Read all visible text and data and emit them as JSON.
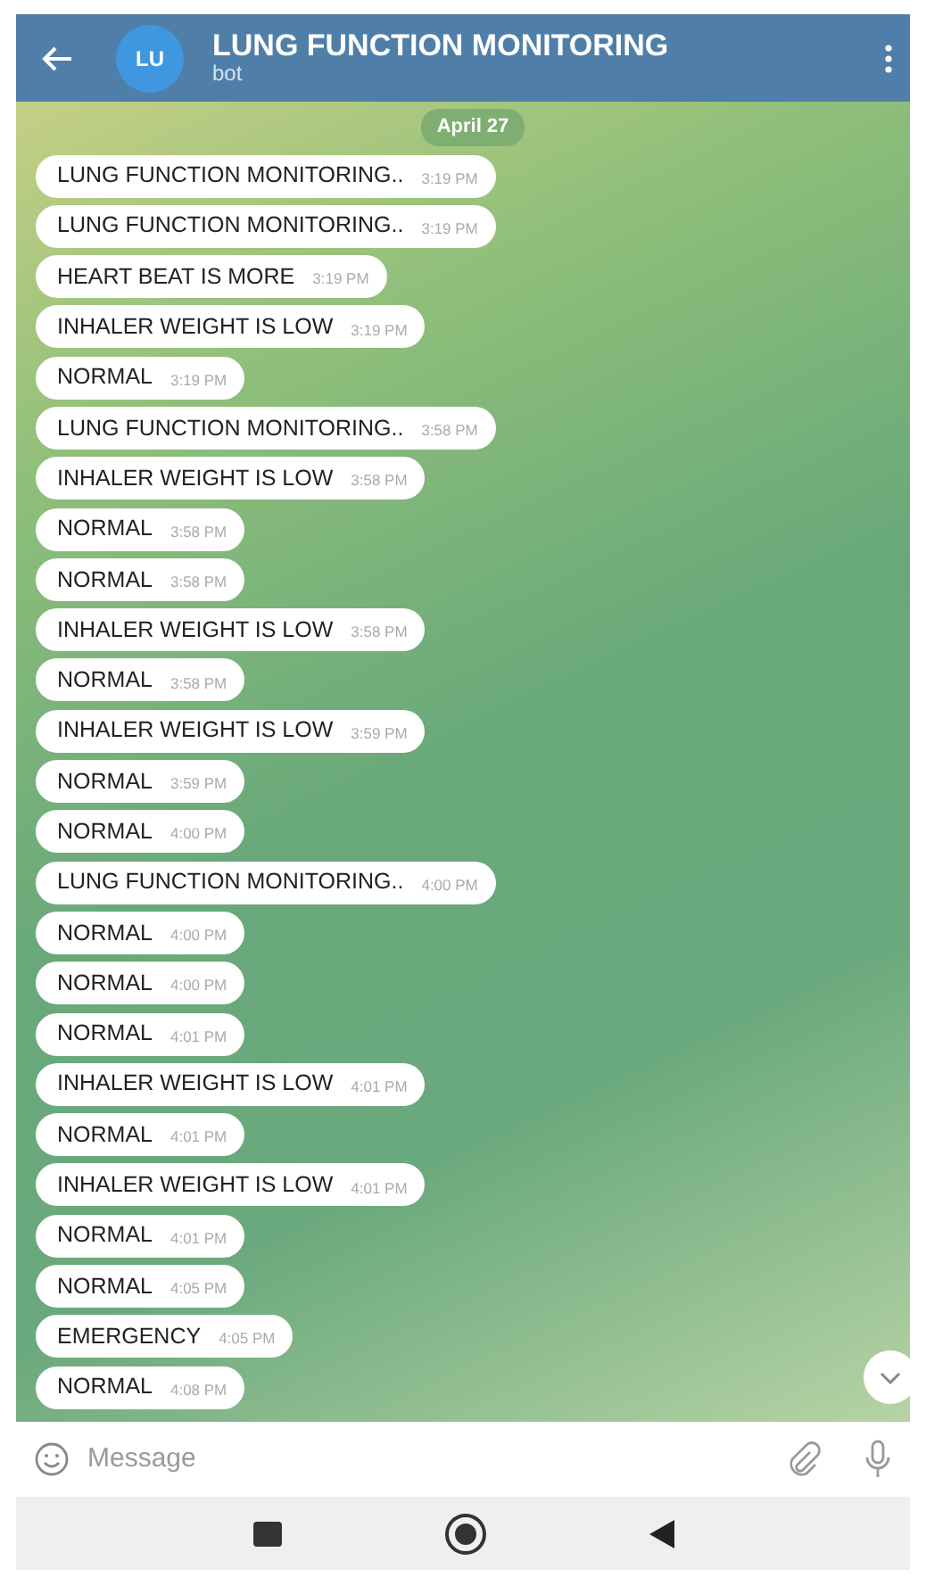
{
  "header": {
    "avatar": "LU",
    "title": "LUNG FUNCTION MONITORING",
    "subtitle": "bot"
  },
  "date_label": "April 27",
  "messages": [
    {
      "text": "LUNG FUNCTION MONITORING..",
      "time": "3:19 PM"
    },
    {
      "text": "LUNG FUNCTION MONITORING..",
      "time": "3:19 PM"
    },
    {
      "text": "HEART BEAT IS MORE",
      "time": "3:19 PM"
    },
    {
      "text": "INHALER WEIGHT IS LOW",
      "time": "3:19 PM"
    },
    {
      "text": "NORMAL",
      "time": "3:19 PM"
    },
    {
      "text": "LUNG FUNCTION MONITORING..",
      "time": "3:58 PM"
    },
    {
      "text": "INHALER WEIGHT IS LOW",
      "time": "3:58 PM"
    },
    {
      "text": "NORMAL",
      "time": "3:58 PM"
    },
    {
      "text": "NORMAL",
      "time": "3:58 PM"
    },
    {
      "text": "INHALER WEIGHT IS LOW",
      "time": "3:58 PM"
    },
    {
      "text": "NORMAL",
      "time": "3:58 PM"
    },
    {
      "text": "INHALER WEIGHT IS LOW",
      "time": "3:59 PM"
    },
    {
      "text": "NORMAL",
      "time": "3:59 PM"
    },
    {
      "text": "NORMAL",
      "time": "4:00 PM"
    },
    {
      "text": "LUNG FUNCTION MONITORING..",
      "time": "4:00 PM"
    },
    {
      "text": "NORMAL",
      "time": "4:00 PM"
    },
    {
      "text": "NORMAL",
      "time": "4:00 PM"
    },
    {
      "text": "NORMAL",
      "time": "4:01 PM"
    },
    {
      "text": "INHALER WEIGHT IS LOW",
      "time": "4:01 PM"
    },
    {
      "text": "NORMAL",
      "time": "4:01 PM"
    },
    {
      "text": "INHALER WEIGHT IS LOW",
      "time": "4:01 PM"
    },
    {
      "text": "NORMAL",
      "time": "4:01 PM"
    },
    {
      "text": "NORMAL",
      "time": "4:05 PM"
    },
    {
      "text": "EMERGENCY",
      "time": "4:05 PM"
    },
    {
      "text": "NORMAL",
      "time": "4:08 PM"
    }
  ],
  "composer": {
    "placeholder": "Message"
  }
}
